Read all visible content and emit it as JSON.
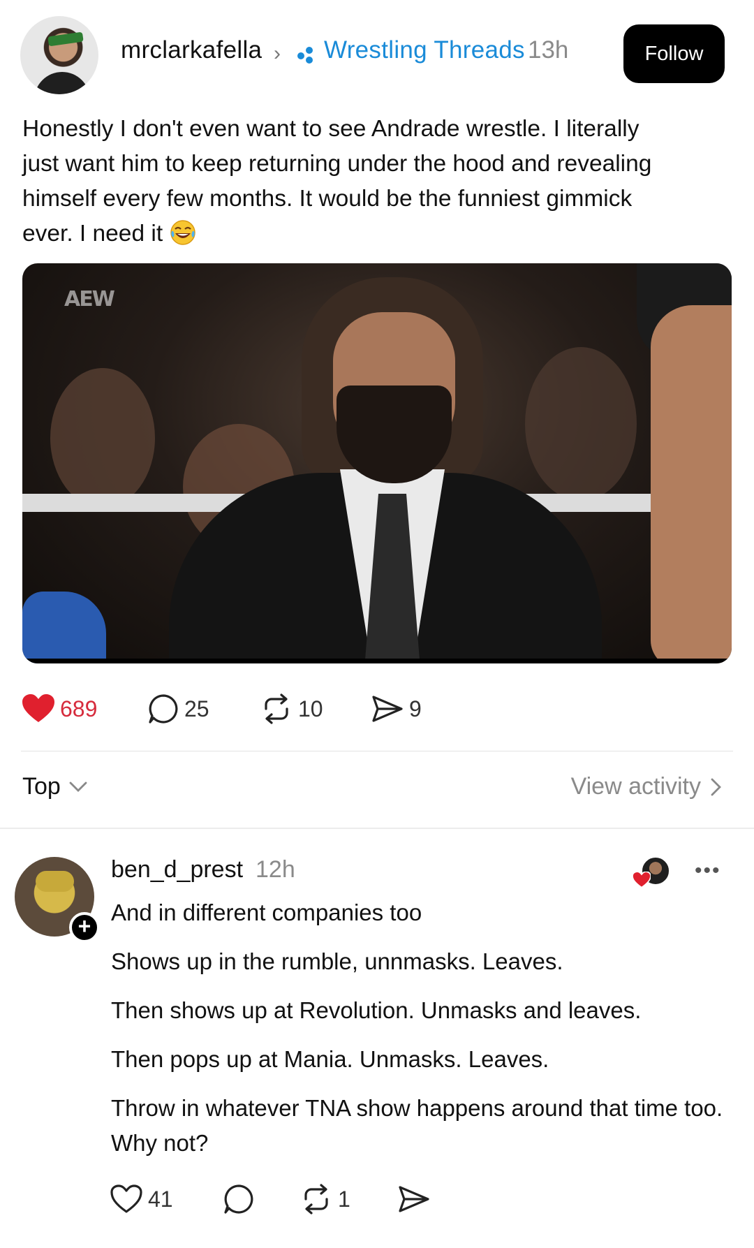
{
  "post": {
    "author": "mrclarkafella",
    "community": "Wrestling Threads",
    "time": "13h",
    "follow_label": "Follow",
    "text_line1": "Honestly I don't even want to see Andrade wrestle. I literally",
    "text_line2": "just want him to keep returning under the hood and revealing",
    "text_line3": "himself every few months. It would be the funniest gimmick",
    "text_line4": "ever. I need it",
    "media_logo": "AEW",
    "likes": "689",
    "comments": "25",
    "reposts": "10",
    "shares": "9"
  },
  "sort": {
    "label": "Top",
    "view_activity": "View activity"
  },
  "reply": {
    "author": "ben_d_prest",
    "time": "12h",
    "paragraphs": [
      "And in different companies too",
      "Shows up in the rumble, unnmasks. Leaves.",
      "Then shows up at Revolution. Unmasks and leaves.",
      "Then pops up at Mania. Unmasks. Leaves.",
      "Throw in whatever TNA show happens around that time too. Why not?"
    ],
    "likes": "41",
    "comments": "",
    "reposts": "1",
    "more": "•••"
  },
  "colors": {
    "like_red": "#e0202e",
    "community_blue": "#1a8bd8"
  },
  "icons": {
    "heart": "heart-icon",
    "comment": "comment-icon",
    "repost": "repost-icon",
    "share": "send-icon"
  }
}
